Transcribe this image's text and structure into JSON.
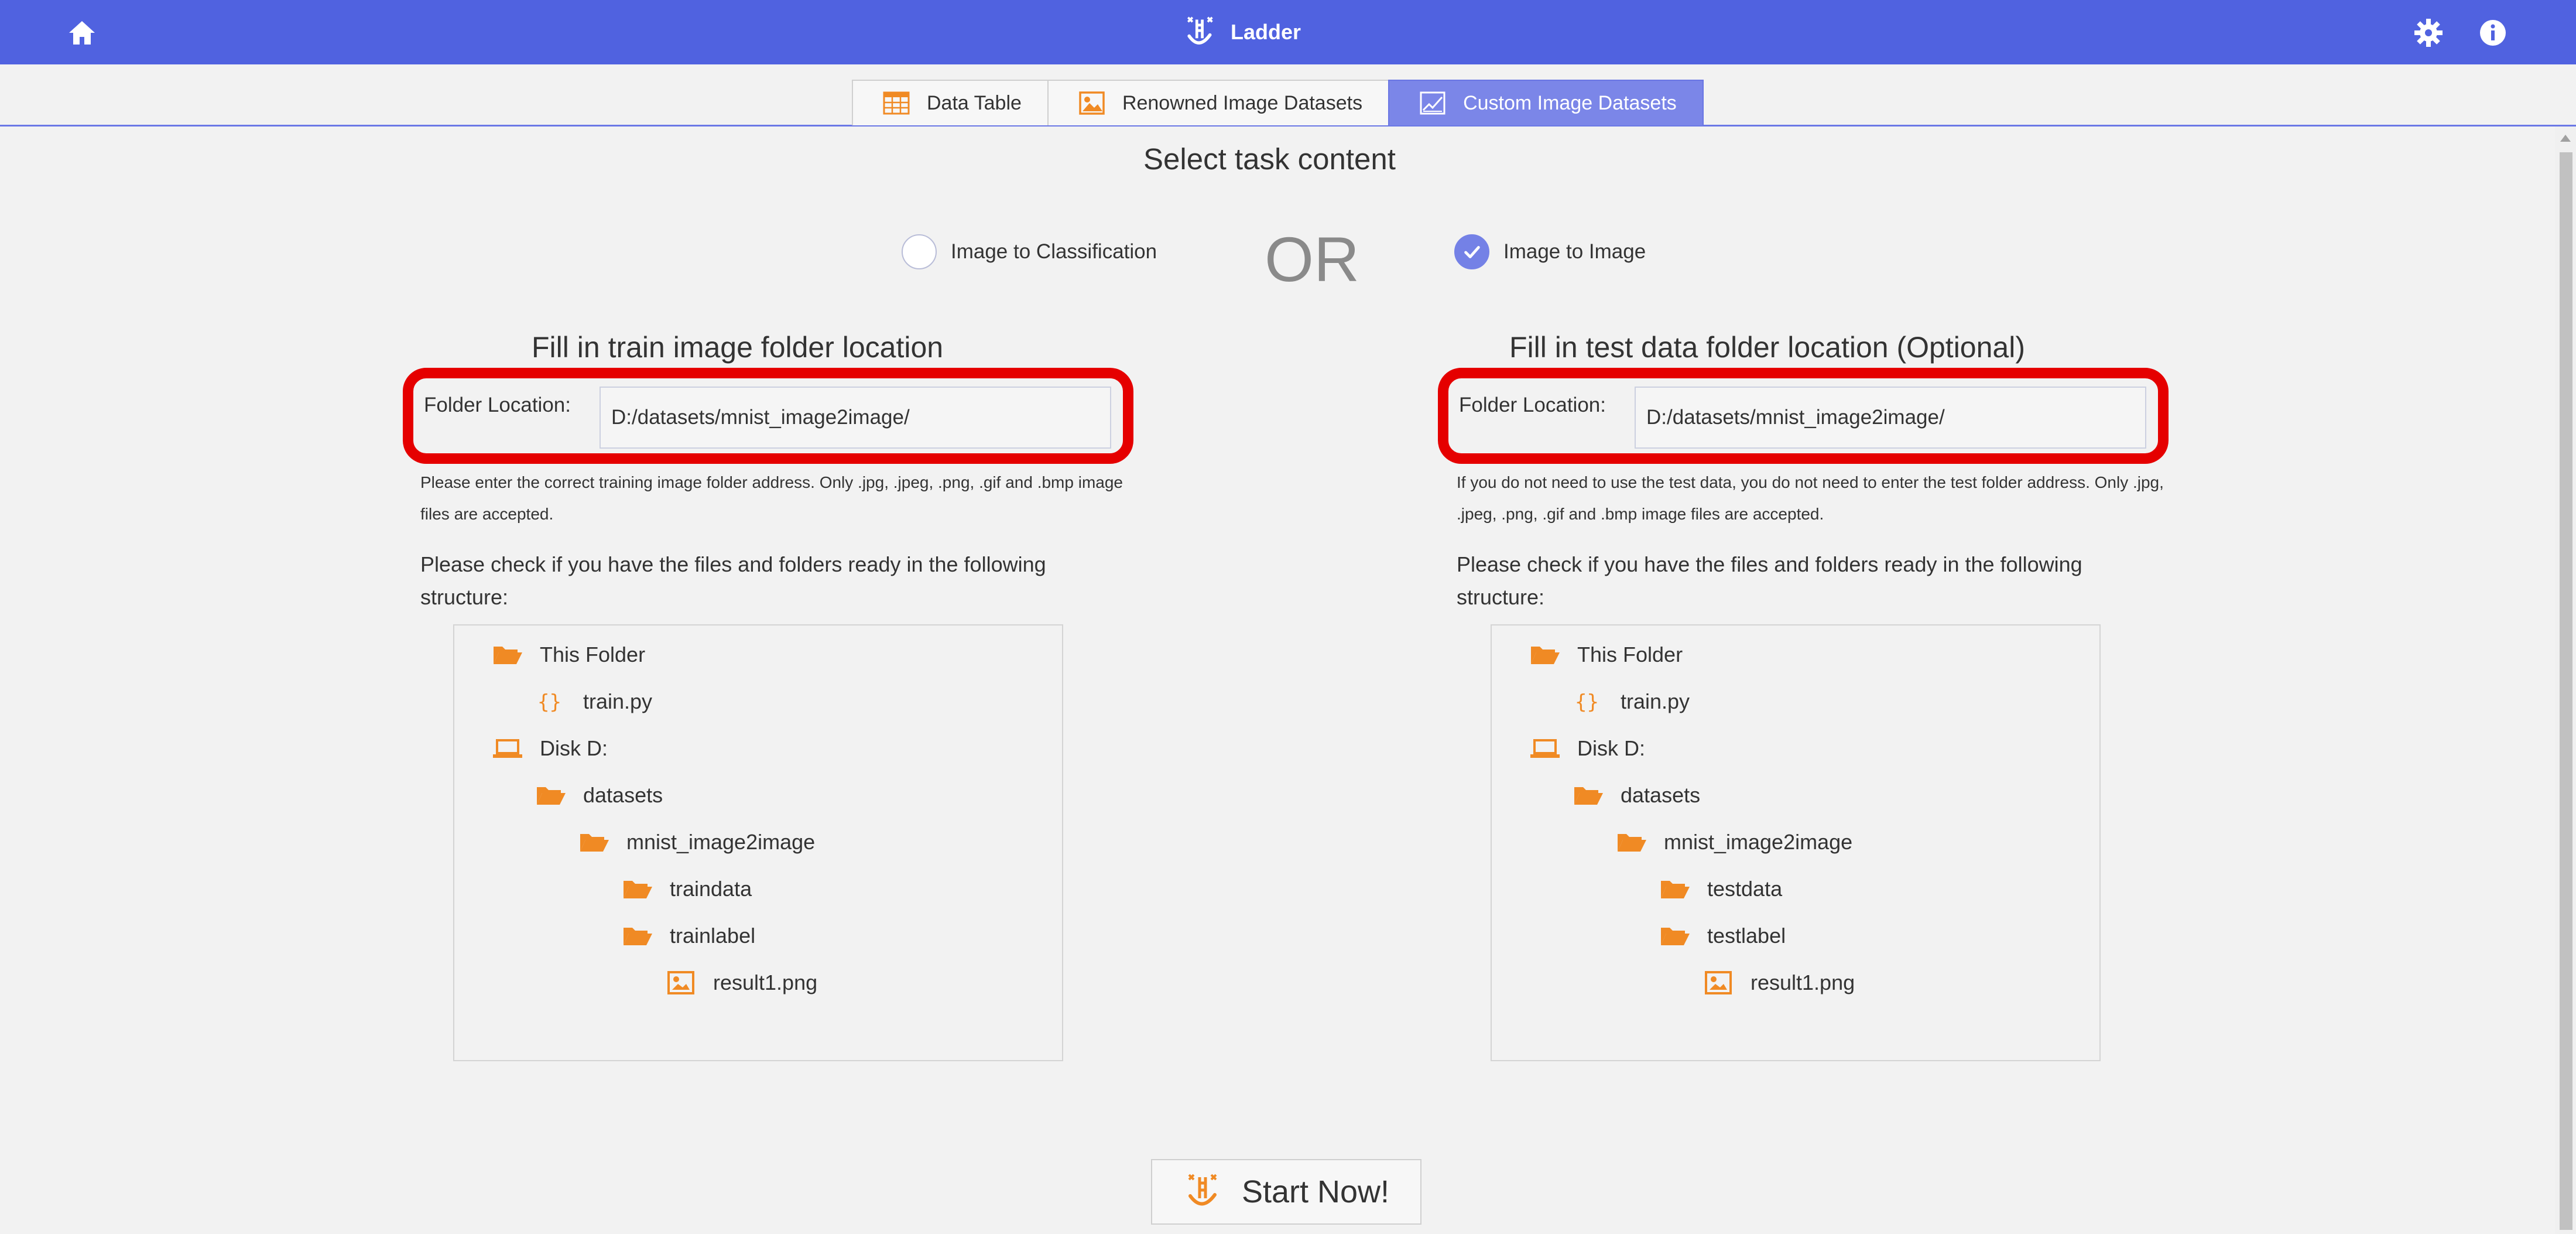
{
  "app": {
    "title": "Ladder"
  },
  "tabs": [
    {
      "label": "Data Table",
      "icon": "table-icon",
      "active": false
    },
    {
      "label": "Renowned Image Datasets",
      "icon": "image-icon",
      "active": false
    },
    {
      "label": "Custom Image Datasets",
      "icon": "chart-image-icon",
      "active": true
    }
  ],
  "task": {
    "heading": "Select task content",
    "option_classification": "Image to Classification",
    "or_text": "OR",
    "option_image": "Image to Image",
    "selected": "Image to Image"
  },
  "train": {
    "title": "Fill in train image folder location",
    "field_label": "Folder Location:",
    "value": "D:/datasets/mnist_image2image/",
    "hint": "Please enter the correct training image folder address. Only .jpg, .jpeg, .png, .gif and .bmp image files are accepted.",
    "check_note": "Please check if you have the files and folders ready in the following structure:",
    "tree": [
      {
        "label": "This Folder",
        "icon": "folder-icon"
      },
      {
        "label": "train.py",
        "icon": "code-icon"
      },
      {
        "label": "Disk D:",
        "icon": "laptop-icon"
      },
      {
        "label": "datasets",
        "icon": "folder-icon"
      },
      {
        "label": "mnist_image2image",
        "icon": "folder-icon"
      },
      {
        "label": "traindata",
        "icon": "folder-icon"
      },
      {
        "label": "trainlabel",
        "icon": "folder-icon"
      },
      {
        "label": "result1.png",
        "icon": "image-file-icon"
      }
    ]
  },
  "test": {
    "title": "Fill in test data folder location (Optional)",
    "field_label": "Folder Location:",
    "value": "D:/datasets/mnist_image2image/",
    "hint": "If you do not need to use the test data, you do not need to enter the test folder address. Only .jpg, .jpeg, .png, .gif and .bmp image files are accepted.",
    "check_note": "Please check if you have the files and folders ready in the following structure:",
    "tree": [
      {
        "label": "This Folder",
        "icon": "folder-icon"
      },
      {
        "label": "train.py",
        "icon": "code-icon"
      },
      {
        "label": "Disk D:",
        "icon": "laptop-icon"
      },
      {
        "label": "datasets",
        "icon": "folder-icon"
      },
      {
        "label": "mnist_image2image",
        "icon": "folder-icon"
      },
      {
        "label": "testdata",
        "icon": "folder-icon"
      },
      {
        "label": "testlabel",
        "icon": "folder-icon"
      },
      {
        "label": "result1.png",
        "icon": "image-file-icon"
      }
    ]
  },
  "start_button": {
    "label": "Start Now!"
  },
  "colors": {
    "header": "#5062e0",
    "active_tab": "#7b86e8",
    "icon_orange": "#f08a24",
    "highlight_red": "#e50000"
  }
}
